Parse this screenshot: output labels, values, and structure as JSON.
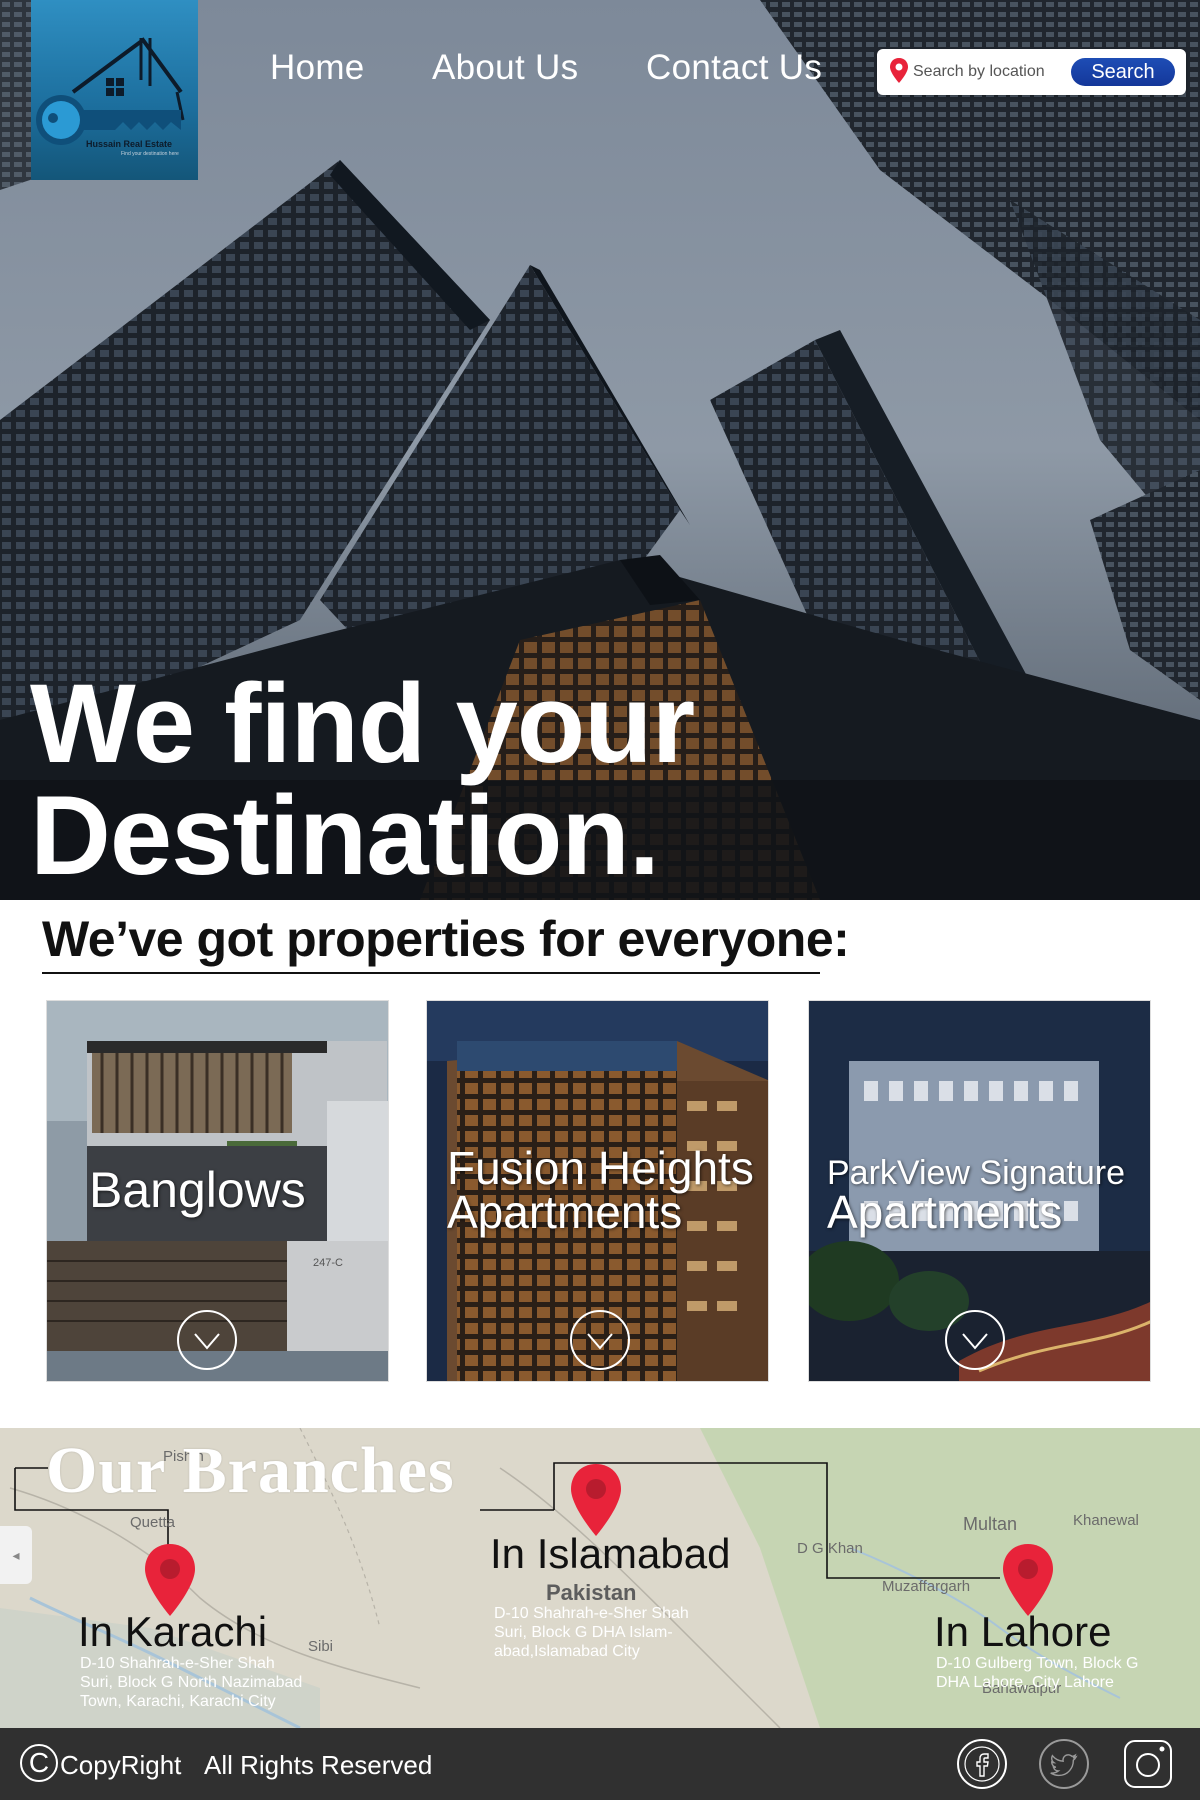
{
  "brand": {
    "logo_text": "Hussain Real Estate",
    "logo_tagline": "Find your destination here"
  },
  "nav": {
    "items": [
      {
        "label": "Home"
      },
      {
        "label": "About Us"
      },
      {
        "label": "Contact Us"
      }
    ]
  },
  "search": {
    "placeholder": "Search by location",
    "button_label": "Search",
    "icon": "location-pin-icon"
  },
  "hero": {
    "headline_line1": "We find your",
    "headline_line2": "Destination."
  },
  "properties": {
    "heading": "We’ve got properties for everyone:",
    "cards": [
      {
        "title_line1": "Banglows",
        "title_line2": "",
        "icon": "chevron-down-icon"
      },
      {
        "title_line1": "Fusion Heights",
        "title_line2": "Apartments",
        "icon": "chevron-down-icon"
      },
      {
        "title_line1": "ParkView Signature",
        "title_line2": "Apartments",
        "icon": "chevron-down-icon"
      }
    ]
  },
  "branches": {
    "heading": "Our Branches",
    "items": [
      {
        "name": "In Karachi",
        "address": "D-10 Shahrah-e-Sher Shah Suri, Block G North Nazimabad Town, Karachi, Karachi City"
      },
      {
        "name": "In Islamabad",
        "address": "D-10 Shahrah-e-Sher Shah Suri, Block G DHA Islam-abad,Islamabad City"
      },
      {
        "name": "In Lahore",
        "address": "D-10 Gulberg Town, Block G DHA Lahore, City Lahore"
      }
    ],
    "map_labels": {
      "country": "Pakistan",
      "quetta": "Quetta",
      "pishin": "Pishin",
      "sibi": "Sibi",
      "multan": "Multan",
      "khanewal": "Khanewal",
      "dgkhan": "D G Khan",
      "muzaffargarh": "Muzaffargarh",
      "bahawalpur": "Bahawalpur"
    },
    "pin_color": "#e8233a"
  },
  "footer": {
    "copy_symbol": "C",
    "copyright": "CopyRight",
    "rights": "All Rights Reserved",
    "social": [
      "facebook-icon",
      "twitter-icon",
      "instagram-icon"
    ]
  },
  "colors": {
    "accent": "#1e4db5",
    "logo_bg": "#1c6e9d",
    "footer_bg": "#303030"
  }
}
